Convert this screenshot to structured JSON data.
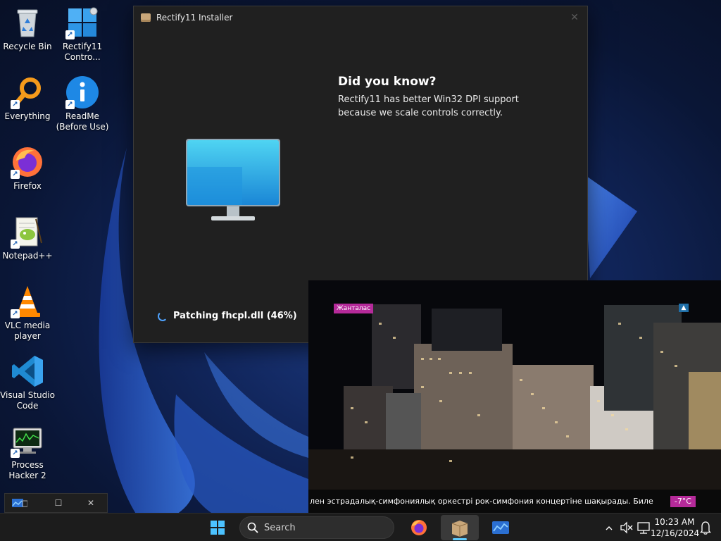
{
  "desktop": {
    "icons": [
      {
        "label": "Recycle Bin"
      },
      {
        "label": "Rectify11 Contro..."
      },
      {
        "label": "Everything"
      },
      {
        "label": "ReadMe (Before Use)"
      },
      {
        "label": "Firefox"
      },
      {
        "label": "Notepad++"
      },
      {
        "label": "VLC media player"
      },
      {
        "label": "Visual Studio Code"
      },
      {
        "label": "Process Hacker 2"
      }
    ]
  },
  "installer": {
    "title": "Rectify11 Installer",
    "close_glyph": "✕",
    "did_you_know_heading": "Did you know?",
    "did_you_know_body": "Rectify11 has better Win32 DPI support because we scale controls correctly.",
    "progress_text": "Patching fhcpl.dll (46%)"
  },
  "video": {
    "channel_badge": "Жанталас",
    "corner_badge": "▲",
    "ticker_text": "лен эстрадалық-симфониялық оркестрі рок-симфония концертіне шақырады. Биле",
    "temperature": "-7°C"
  },
  "mini_toolbar": {
    "maximize_glyph": "☐",
    "close_glyph": "✕"
  },
  "taskbar": {
    "search_placeholder": "Search",
    "clock_time": "10:23 AM",
    "clock_date": "12/16/2024"
  },
  "colors": {
    "accent": "#60cdff",
    "badge_magenta": "#b52a9a",
    "window_bg": "#202020",
    "taskbar_bg": "#1c1c1c"
  }
}
